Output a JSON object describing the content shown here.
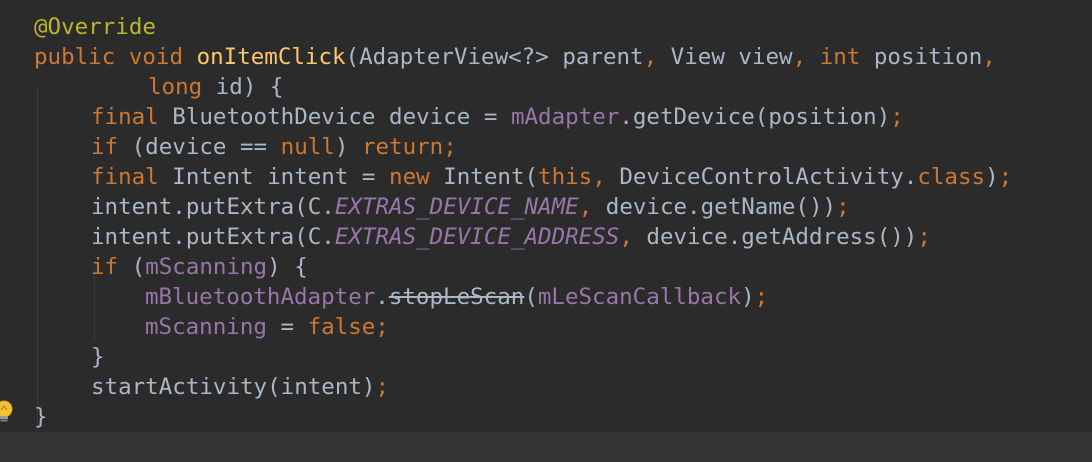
{
  "code": {
    "ann_override": "@Override",
    "kw_public": "public",
    "kw_void": "void",
    "fn_onItemClick": "onItemClick",
    "sig_params_1": "(AdapterView<?> parent",
    "comma": ",",
    "sig_view": " View view",
    "kw_int": "int",
    "sig_position": " position",
    "kw_long": "long",
    "sig_id": " id) {",
    "kw_final": "final",
    "l3_type": " BluetoothDevice device = ",
    "field_mAdapter": "mAdapter",
    "l3_call": ".getDevice(position)",
    "semicolon": ";",
    "kw_if": "if",
    "l4_cond": " (device == ",
    "kw_null": "null",
    "l4_close": ") ",
    "kw_return": "return",
    "l5_type": " Intent intent = ",
    "kw_new": "new",
    "l5_ctor": " Intent(",
    "kw_this": "this",
    "l5_cls": " DeviceControlActivity.",
    "kw_class": "class",
    "close_paren": ")",
    "l6_call": "intent.putExtra(C.",
    "static_name": "EXTRAS_DEVICE_NAME",
    "l6_arg": " device.getName())",
    "static_address": "EXTRAS_DEVICE_ADDRESS",
    "l7_arg": " device.getAddress())",
    "l8_open": " (",
    "field_mScanning": "mScanning",
    "l8_close": ") {",
    "field_mBluetoothAdapter": "mBluetoothAdapter",
    "dot": ".",
    "fn_stopLeScan": "stopLeScan",
    "open_paren": "(",
    "field_mLeScanCallback": "mLeScanCallback",
    "l10_assign": " = ",
    "kw_false": "false",
    "close_brace": "}",
    "l12_call": "startActivity(intent)"
  },
  "icons": {
    "intention_bulb": "lightbulb-icon"
  }
}
